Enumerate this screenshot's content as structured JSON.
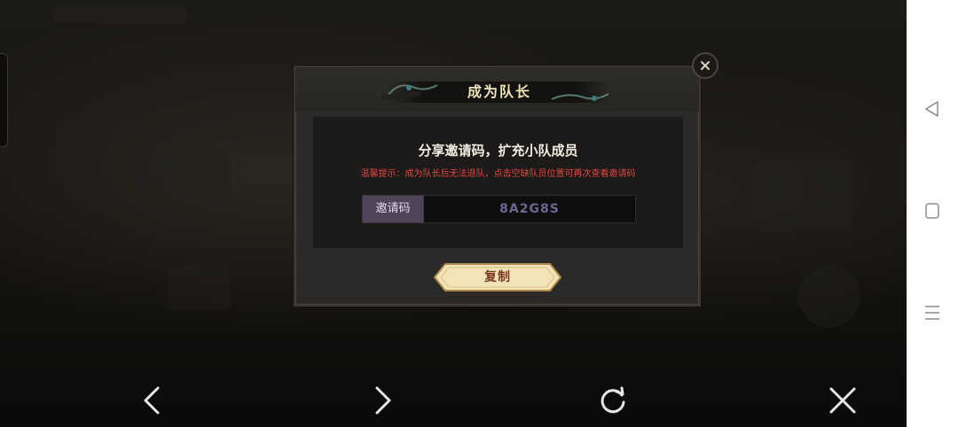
{
  "dialog": {
    "title": "成为队长",
    "subtitle": "分享邀请码，扩充小队成员",
    "hint": "温馨提示：成为队长后无法退队，点击空缺队员位置可再次查看邀请码",
    "code_label": "邀请码",
    "code_value": "8A2G8S",
    "copy_label": "复制",
    "close_icon": "close-icon"
  },
  "bottom_nav": {
    "items": [
      "back-icon",
      "forward-icon",
      "refresh-icon",
      "close-icon"
    ]
  },
  "system_nav": {
    "items": [
      "triangle-back-icon",
      "square-home-icon",
      "menu-icon"
    ]
  },
  "colors": {
    "title_text": "#f0e2b8",
    "hint_text": "#e0453c",
    "code_label_bg": "#4f4458",
    "code_value_text": "#6e6690",
    "copy_button_bg": "#f3e4b8",
    "copy_button_text": "#7a3a22"
  }
}
